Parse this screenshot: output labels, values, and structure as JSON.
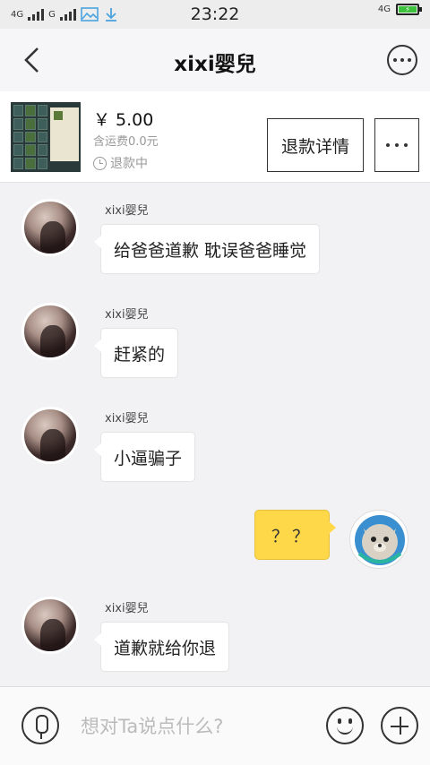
{
  "status_bar": {
    "network1": "4G",
    "network2": "G",
    "time": "23:22",
    "right_network": "4G",
    "battery_charging": true
  },
  "header": {
    "title": "xixi婴兒"
  },
  "product": {
    "price": "￥ 5.00",
    "shipping": "含运费0.0元",
    "status": "退款中",
    "refund_button": "退款详情"
  },
  "messages": [
    {
      "sender": "xixi婴兒",
      "text": "给爸爸道歉 耽误爸爸睡觉",
      "side": "left"
    },
    {
      "sender": "xixi婴兒",
      "text": "赶紧的",
      "side": "left"
    },
    {
      "sender": "xixi婴兒",
      "text": "小逼骗子",
      "side": "left"
    },
    {
      "sender": "",
      "text": "？？",
      "side": "right"
    },
    {
      "sender": "xixi婴兒",
      "text": "道歉就给你退",
      "side": "left"
    }
  ],
  "input_bar": {
    "placeholder": "想对Ta说点什么?"
  },
  "colors": {
    "my_bubble": "#ffd84a",
    "background": "#f2f2f5"
  }
}
